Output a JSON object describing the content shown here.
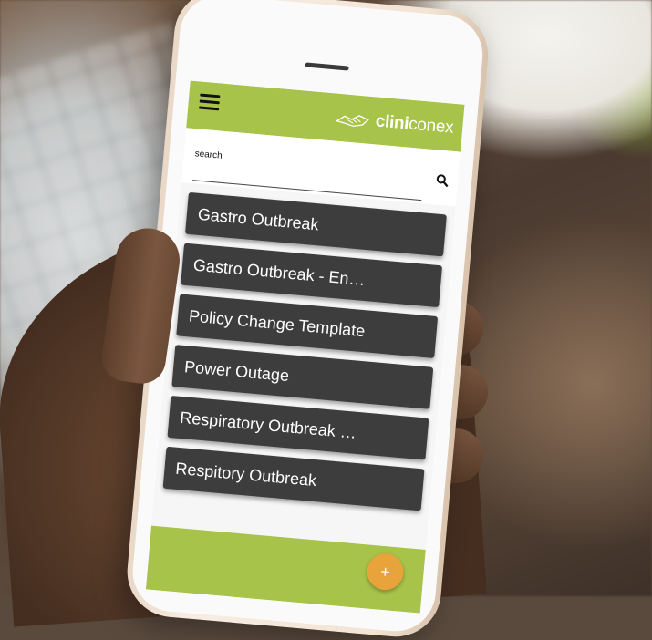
{
  "header": {
    "menu_icon": "hamburger-menu-icon",
    "logo_bold": "clini",
    "logo_light": "conex",
    "logo_mark": "handshake-icon"
  },
  "search": {
    "placeholder": "search",
    "icon": "search-icon"
  },
  "templates": [
    {
      "label": "Gastro Outbreak"
    },
    {
      "label": "Gastro Outbreak - En…"
    },
    {
      "label": "Policy Change Template"
    },
    {
      "label": "Power Outage"
    },
    {
      "label": "Respiratory Outbreak …"
    },
    {
      "label": "Respitory Outbreak"
    }
  ],
  "fab": {
    "label": "+",
    "icon": "add-icon"
  },
  "colors": {
    "brand_green": "#a7c34a",
    "card_dark": "#3d3d3d",
    "fab_orange": "#e8a33a"
  }
}
